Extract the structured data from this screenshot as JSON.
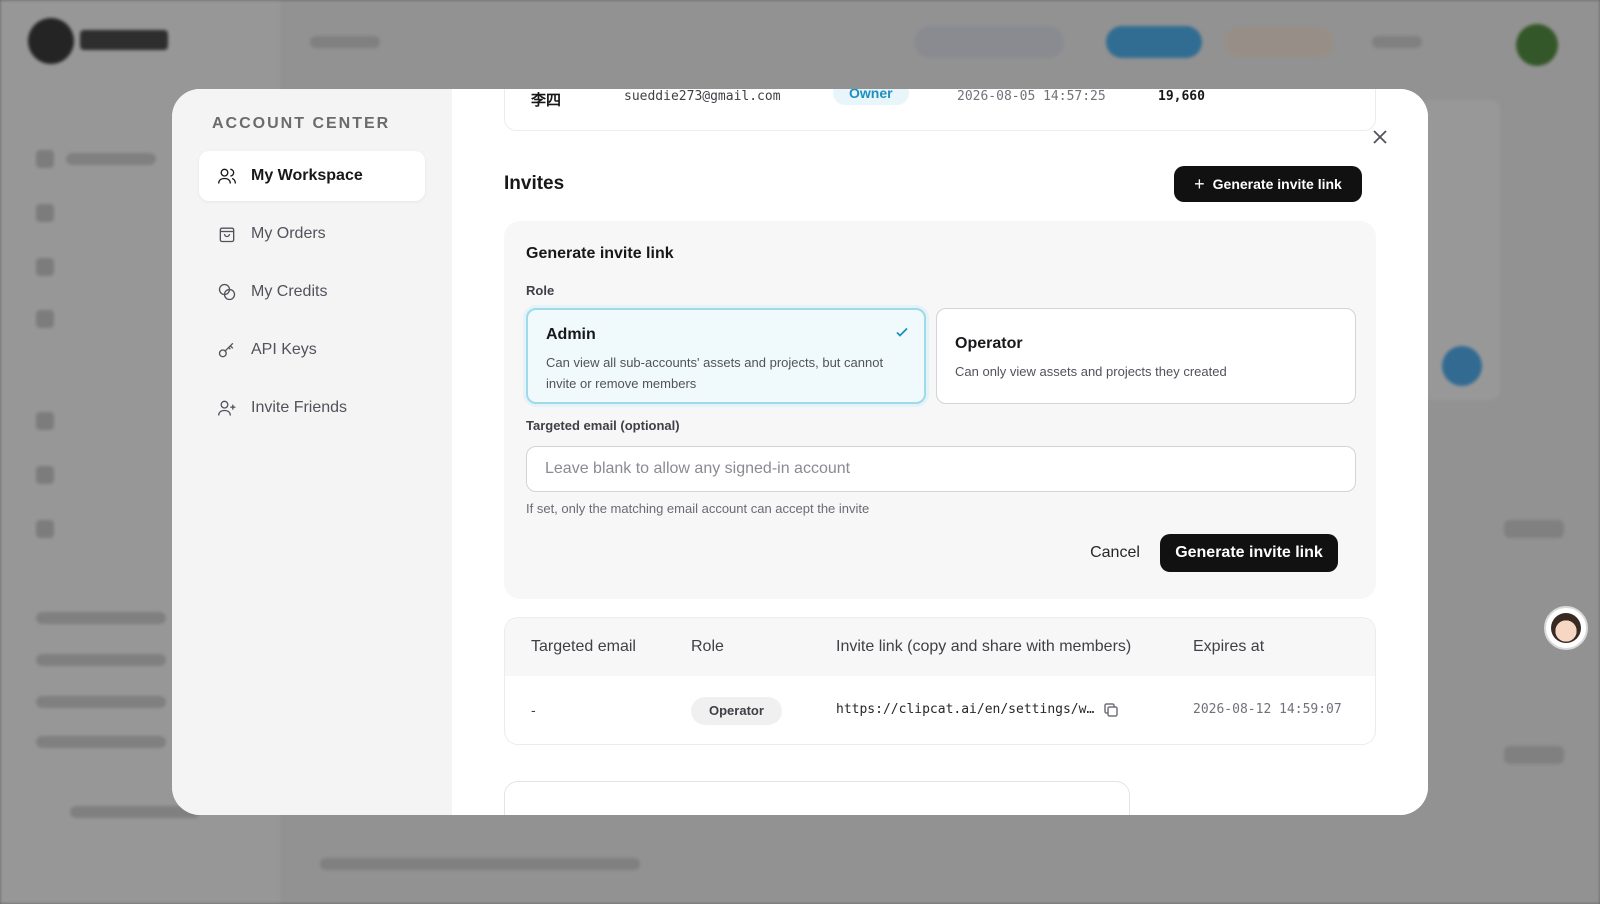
{
  "account_center": {
    "title": "ACCOUNT CENTER",
    "nav": [
      {
        "label": "My Workspace",
        "icon": "users-icon",
        "active": true
      },
      {
        "label": "My Orders",
        "icon": "shopping-bag-icon",
        "active": false
      },
      {
        "label": "My Credits",
        "icon": "coins-icon",
        "active": false
      },
      {
        "label": "API Keys",
        "icon": "key-icon",
        "active": false
      },
      {
        "label": "Invite Friends",
        "icon": "user-plus-icon",
        "active": false
      }
    ]
  },
  "member_row": {
    "name": "李四",
    "email": "sueddie273@gmail.com",
    "role": "Owner",
    "date": "2026-08-05 14:57:25",
    "credits": "19,660"
  },
  "invites": {
    "title": "Invites",
    "generate_button": "Generate invite link",
    "form": {
      "title": "Generate invite link",
      "role_label": "Role",
      "roles": [
        {
          "name": "Admin",
          "description": "Can view all sub-accounts' assets and projects, but cannot invite or remove members",
          "selected": true
        },
        {
          "name": "Operator",
          "description": "Can only view assets and projects they created",
          "selected": false
        }
      ],
      "email_label": "Targeted email (optional)",
      "email_placeholder": "Leave blank to allow any signed-in account",
      "email_value": "",
      "email_hint": "If set, only the matching email account can accept the invite",
      "cancel_label": "Cancel",
      "submit_label": "Generate invite link"
    },
    "table": {
      "headers": [
        "Targeted email",
        "Role",
        "Invite link (copy and share with members)",
        "Expires at"
      ],
      "rows": [
        {
          "email": "-",
          "role": "Operator",
          "link": "https://clipcat.ai/en/settings/w…",
          "expires": "2026-08-12 14:59:07"
        }
      ]
    }
  },
  "colors": {
    "accent": "#1e8fbf",
    "primary_button": "#111111",
    "selected_card_bg": "#f0fafc"
  }
}
